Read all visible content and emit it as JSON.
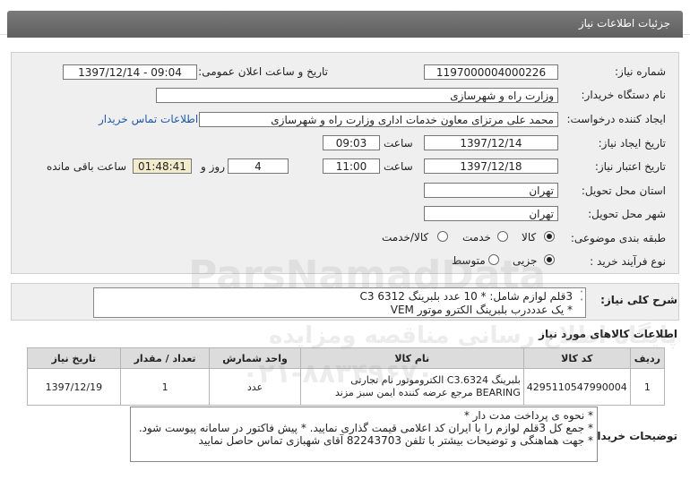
{
  "header": {
    "title": "جزئیات اطلاعات نیاز"
  },
  "form": {
    "need_number_label": "شماره نیاز:",
    "need_number": "1197000004000226",
    "announce_label": "تاریخ و ساعت اعلان عمومی:",
    "announce_value": "1397/12/14 - 09:04",
    "buyer_org_label": "نام دستگاه خریدار:",
    "buyer_org": "وزارت راه و شهرسازی",
    "requester_label": "ایجاد کننده درخواست:",
    "requester": "محمد علی  مرتزای معاون خدمات اداری وزارت راه و شهرسازی",
    "contact_link": "اطلاعات تماس خریدار",
    "created_label": "تاریخ ایجاد نیاز:",
    "created_date": "1397/12/14",
    "time_label": "ساعت",
    "created_time": "09:03",
    "validity_label": "تاریخ اعتبار نیاز:",
    "validity_date": "1397/12/18",
    "validity_time": "11:00",
    "days_value": "4",
    "days_label": "روز و",
    "remaining_time": "01:48:41",
    "remaining_label": "ساعت باقی مانده",
    "province_label": "استان محل تحویل:",
    "province": "تهران",
    "city_label": "شهر محل تحویل:",
    "city": "تهران",
    "category_label": "طبقه بندی موضوعی:",
    "category_options": [
      "کالا",
      "خدمت",
      "کالا/خدمت"
    ],
    "process_label": "نوع فرآیند خرید :",
    "process_options": [
      "جزیی",
      "متوسط"
    ]
  },
  "description": {
    "label": "شرح کلی نیاز:",
    "line1": "3قلم لوازم شامل: * 10 عدد بلبرینگ 6312  C3",
    "line2": "* یک عدددرب بلبرینگ الکترو موتور VEM"
  },
  "items": {
    "section_title": "اطلاعات کالاهای مورد نیاز",
    "columns": [
      "ردیف",
      "کد کالا",
      "نام کالا",
      "واحد شمارش",
      "تعداد / مقدار",
      "تاریخ نیاز"
    ],
    "rows": [
      {
        "row": "1",
        "code": "4295110547990004",
        "name": "بلبرینگ C3.6324 الکتروموتور نام تجارتی BEARING مرجع عرضه کننده ایمن سبز مزند",
        "unit": "عدد",
        "qty": "1",
        "date": "1397/12/19"
      }
    ]
  },
  "notes": {
    "label": "توضیحات خریدار:",
    "line1": "* نحوه ی پرداخت مدت دار *",
    "line2": "* جمع کل 3قلم لوازم را با ایران کد اعلامی قیمت گذاری نمایید.   * پیش  فاکتور در سامانه پیوست شود.",
    "line3": "* جهت هماهنگی و توضیحات بیشتر با تلفن 82243703 آقای شهبازی تماس حاصل نمایید"
  },
  "watermark": {
    "brand": "ParsNamadData",
    "tagline": "پایگاه اطلاع رسانی مناقصه ومزایده",
    "phone": "۰۲۱-۸۸۳۴۹۶۷۰"
  },
  "colors": {
    "title_bar": "#666666",
    "link": "#1e5aa8",
    "remaining_bg": "#f3eccc"
  }
}
